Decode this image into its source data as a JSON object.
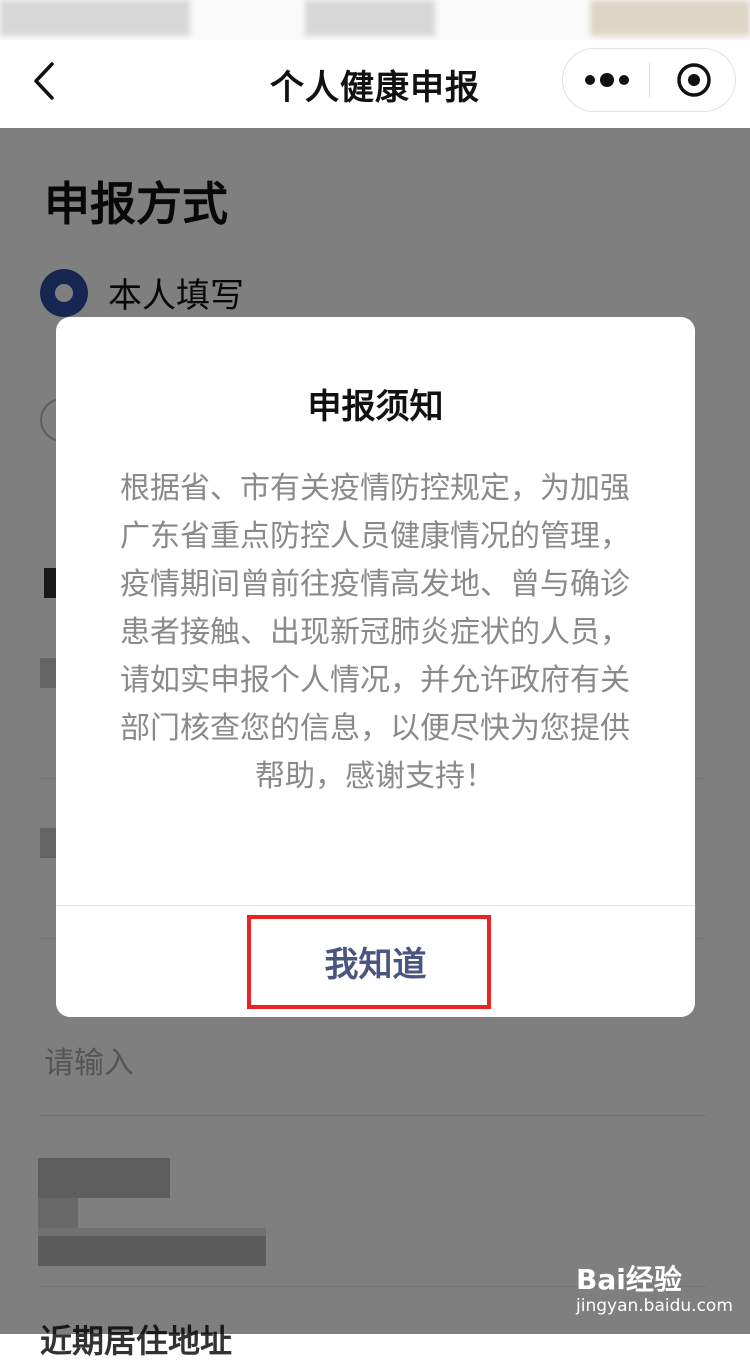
{
  "nav": {
    "title": "个人健康申报",
    "back_icon": "chevron-left-icon",
    "more_icon": "more-dots-icon",
    "close_icon": "target-close-icon"
  },
  "form": {
    "section_title": "申报方式",
    "radio_selected_label": "本人填写",
    "field_placeholder": "请输入",
    "bottom_label": "近期居住地址"
  },
  "dialog": {
    "title": "申报须知",
    "body": "根据省、市有关疫情防控规定，为加强广东省重点防控人员健康情况的管理，疫情期间曾前往疫情高发地、曾与确诊患者接触、出现新冠肺炎症状的人员，请如实申报个人情况，并允许政府有关部门核查您的信息，以便尽快为您提供帮助，感谢支持！",
    "confirm_label": "我知道"
  },
  "watermark": {
    "brand": "Bai经验",
    "url": "jingyan.baidu.com"
  },
  "colors": {
    "accent": "#2b4fa3",
    "button_text": "#4a5580",
    "highlight": "#ee2222",
    "overlay": "rgba(0,0,0,0.5)"
  }
}
